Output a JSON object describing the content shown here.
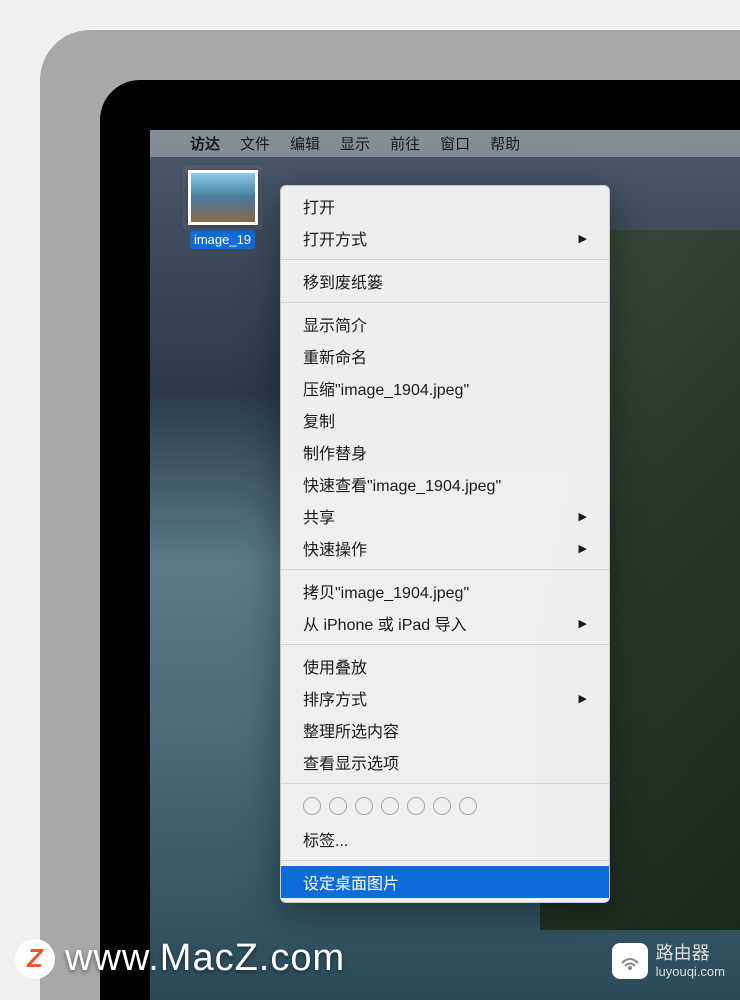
{
  "menubar": {
    "app": "访达",
    "items": [
      "文件",
      "编辑",
      "显示",
      "前往",
      "窗口",
      "帮助"
    ]
  },
  "desktop_icon": {
    "label": "image_19"
  },
  "context_menu": {
    "groups": [
      [
        {
          "label": "打开",
          "submenu": false
        },
        {
          "label": "打开方式",
          "submenu": true
        }
      ],
      [
        {
          "label": "移到废纸篓",
          "submenu": false
        }
      ],
      [
        {
          "label": "显示简介",
          "submenu": false
        },
        {
          "label": "重新命名",
          "submenu": false
        },
        {
          "label": "压缩\"image_1904.jpeg\"",
          "submenu": false
        },
        {
          "label": "复制",
          "submenu": false
        },
        {
          "label": "制作替身",
          "submenu": false
        },
        {
          "label": "快速查看\"image_1904.jpeg\"",
          "submenu": false
        },
        {
          "label": "共享",
          "submenu": true
        },
        {
          "label": "快速操作",
          "submenu": true
        }
      ],
      [
        {
          "label": "拷贝\"image_1904.jpeg\"",
          "submenu": false
        },
        {
          "label": "从 iPhone 或 iPad 导入",
          "submenu": true
        }
      ],
      [
        {
          "label": "使用叠放",
          "submenu": false
        },
        {
          "label": "排序方式",
          "submenu": true
        },
        {
          "label": "整理所选内容",
          "submenu": false
        },
        {
          "label": "查看显示选项",
          "submenu": false
        }
      ]
    ],
    "tags_label": "标签...",
    "selected_item": "设定桌面图片"
  },
  "watermarks": {
    "left": "www.MacZ.com",
    "right_title": "路由器",
    "right_sub": "luyouqi.com"
  }
}
